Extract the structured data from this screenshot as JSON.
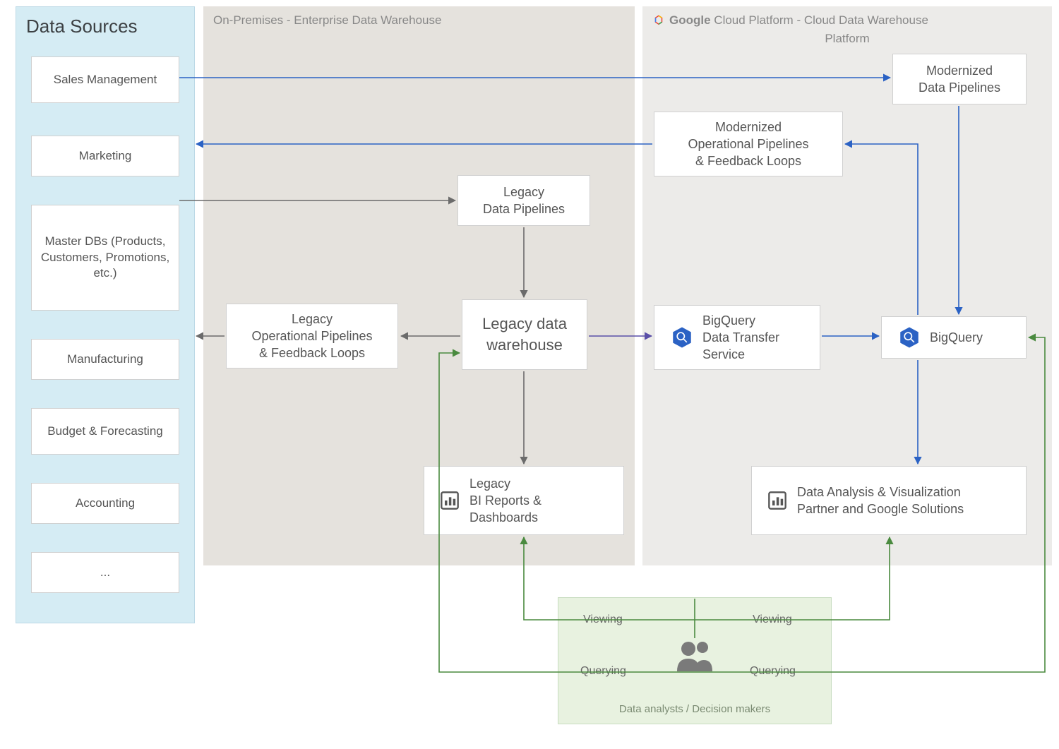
{
  "zones": {
    "data_sources": {
      "title": "Data Sources"
    },
    "on_prem": {
      "title": "On-Premises - Enterprise Data Warehouse"
    },
    "gcp": {
      "brand_bold": "Google",
      "brand_rest": " Cloud Platform",
      "subtitle": " - Cloud Data Warehouse",
      "subtitle2": "Platform"
    }
  },
  "data_sources": [
    "Sales Management",
    "Marketing",
    "Master DBs (Products, Customers, Promotions, etc.)",
    "Manufacturing",
    "Budget & Forecasting",
    "Accounting",
    "..."
  ],
  "onprem": {
    "legacy_pipelines": "Legacy\nData Pipelines",
    "legacy_ops": "Legacy\nOperational Pipelines\n& Feedback Loops",
    "legacy_dw": "Legacy data\nwarehouse",
    "legacy_bi": "Legacy\nBI Reports &\nDashboards"
  },
  "gcp": {
    "modern_pipelines": "Modernized\nData Pipelines",
    "modern_ops": "Modernized\nOperational Pipelines\n& Feedback Loops",
    "bq_dts": "BigQuery\nData Transfer\nService",
    "bq": "BigQuery",
    "dataviz": "Data Analysis & Visualization\nPartner and Google Solutions"
  },
  "users": {
    "caption": "Data analysts / Decision makers",
    "viewing": "Viewing",
    "querying": "Querying"
  },
  "colors": {
    "blue": "#2b62c4",
    "gray": "#6b6b6b",
    "green": "#4a8a3f",
    "purple": "#5a4fa8",
    "bq_hex": "#2b62c4"
  }
}
